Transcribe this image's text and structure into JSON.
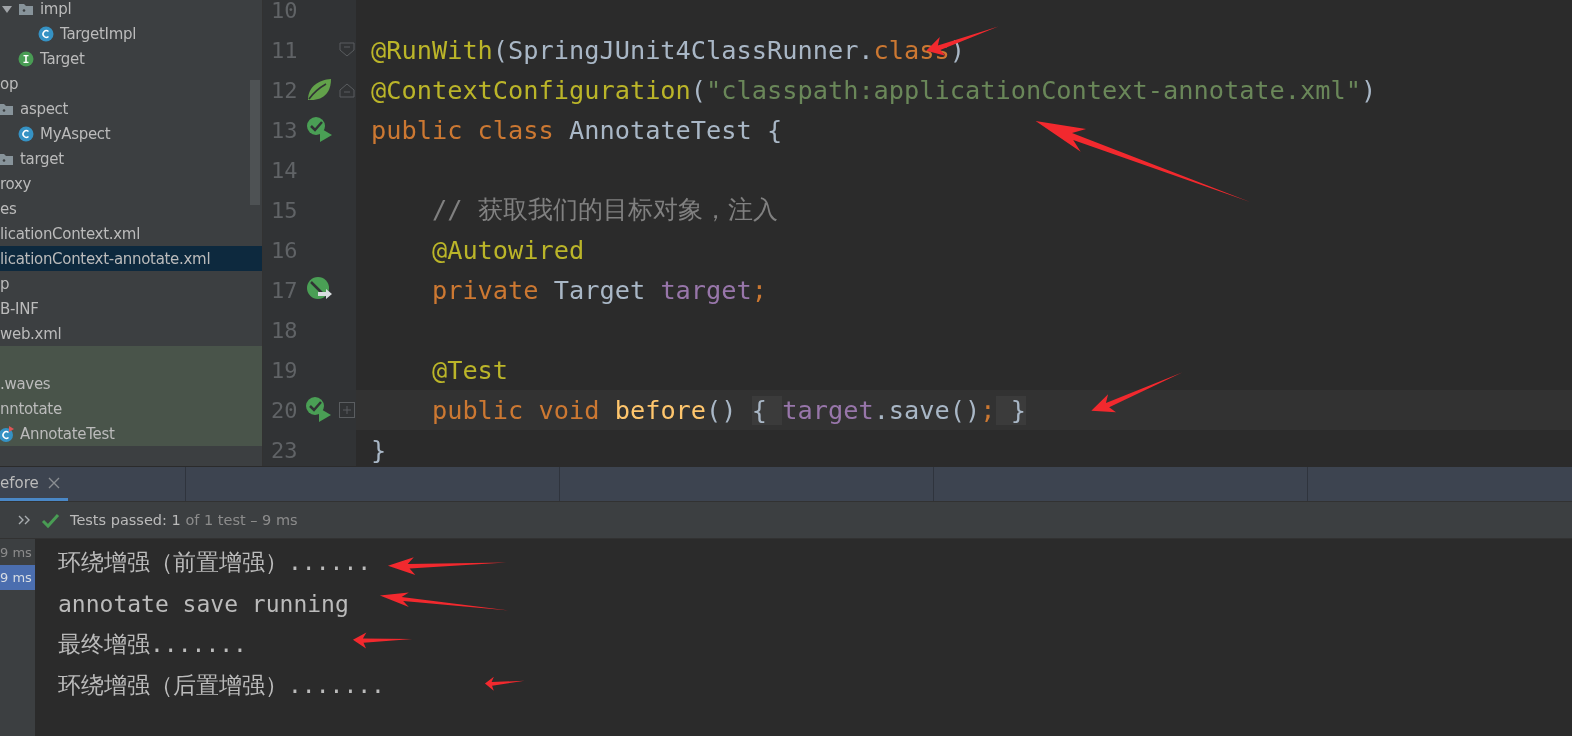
{
  "sidebar": {
    "tree": [
      {
        "kind": "offscreen",
        "children": [
          {
            "kind": "offscreen",
            "children": [
              {
                "kind": "folder",
                "label": "impl",
                "expanded": true,
                "selected": false,
                "children": [
                  {
                    "kind": "class",
                    "label": "TargetImpl",
                    "selected": false
                  }
                ]
              },
              {
                "kind": "interface",
                "label": "Target",
                "selected": false
              }
            ]
          }
        ]
      },
      {
        "kind": "folder",
        "label": "op",
        "expanded": true,
        "selected": false,
        "children": [
          {
            "kind": "folder",
            "label": "aspect",
            "expanded": true,
            "selected": false,
            "children": [
              {
                "kind": "class",
                "label": "MyAspect",
                "selected": false
              }
            ]
          },
          {
            "kind": "folder",
            "label": "target",
            "selected": false
          }
        ]
      },
      {
        "kind": "folder",
        "label": "roxy",
        "selected": false
      },
      {
        "kind": "folder",
        "label": "es",
        "selected": false
      },
      {
        "kind": "file",
        "label": "licationContext.xml",
        "selected": false
      },
      {
        "kind": "file",
        "label": "licationContext-annotate.xml",
        "selected": true
      },
      {
        "kind": "folder",
        "label": "p",
        "selected": false
      },
      {
        "kind": "folder",
        "label": "B-INF",
        "selected": false
      },
      {
        "kind": "file",
        "label": "web.xml",
        "selected": false
      },
      {
        "kind": "folder",
        "test_source": true,
        "selected": false
      },
      {
        "kind": "folder",
        "label": ".waves",
        "test_source": true,
        "selected": false
      },
      {
        "kind": "folder",
        "label": "nntotate",
        "test_source": true,
        "expanded": true,
        "selected": false,
        "children": [
          {
            "kind": "test-class",
            "label": "AnnotateTest",
            "test_source": true,
            "selected": false
          }
        ]
      }
    ]
  },
  "editor": {
    "lines": [
      {
        "number": "10"
      },
      {
        "number": "11",
        "fold_marker": {
          "kind": "start"
        },
        "arrow_mark": true,
        "tokens": [
          {
            "kind": "annotation",
            "text": "@RunWith"
          },
          {
            "kind": "plain",
            "text": "(SpringJUnit4ClassRunner."
          },
          {
            "kind": "keyword",
            "text": "class"
          },
          {
            "kind": "plain",
            "text": ")"
          }
        ]
      },
      {
        "number": "12",
        "gutter_mark": {
          "kind": "leaf"
        },
        "fold_marker": {
          "kind": "end"
        },
        "tokens": [
          {
            "kind": "annotation",
            "text": "@ContextConfiguration"
          },
          {
            "kind": "plain",
            "text": "("
          },
          {
            "kind": "string",
            "text": "\"classpath:applicationContext-annotate.xml\""
          },
          {
            "kind": "plain",
            "text": ")"
          }
        ]
      },
      {
        "number": "13",
        "gutter_mark": {
          "kind": "run"
        },
        "arrow_mark": true,
        "tokens": [
          {
            "kind": "keyword",
            "text": "public class "
          },
          {
            "kind": "plain",
            "text": "AnnotateTest {"
          }
        ]
      },
      {
        "number": "14"
      },
      {
        "number": "15",
        "tokens": [
          {
            "kind": "comment",
            "text": "    // 获取我们的目标对象，注入"
          }
        ]
      },
      {
        "number": "16",
        "tokens": [
          {
            "kind": "annotation",
            "text": "    @Autowired"
          }
        ]
      },
      {
        "number": "17",
        "gutter_mark": {
          "kind": "autowired"
        },
        "tokens": [
          {
            "kind": "keyword",
            "text": "    private "
          },
          {
            "kind": "plain",
            "text": "Target "
          },
          {
            "kind": "field",
            "text": "target"
          },
          {
            "kind": "keyword",
            "text": ";"
          }
        ]
      },
      {
        "number": "18"
      },
      {
        "number": "19",
        "tokens": [
          {
            "kind": "annotation",
            "text": "    @Test"
          }
        ]
      },
      {
        "number": "20",
        "gutter_mark": {
          "kind": "run"
        },
        "fold_marker": {
          "kind": "collapsed"
        },
        "current": true,
        "arrow_mark": true,
        "tokens": [
          {
            "kind": "keyword",
            "text": "    public void "
          },
          {
            "kind": "method",
            "text": "before"
          },
          {
            "kind": "plain",
            "text": "() "
          },
          {
            "kind": "folded",
            "text": "{ "
          },
          {
            "kind": "field",
            "text": "target"
          },
          {
            "kind": "plain",
            "text": ".save()"
          },
          {
            "kind": "keyword",
            "text": ";"
          },
          {
            "kind": "folded",
            "text": " }"
          }
        ]
      },
      {
        "number": "23",
        "tokens": [
          {
            "kind": "plain",
            "text": "}"
          }
        ]
      }
    ]
  },
  "run_panel": {
    "tabs": [
      {
        "label": "efore",
        "selected": true
      }
    ],
    "status": {
      "passed": "Tests passed: 1",
      "detail": "of 1 test – 9 ms"
    },
    "durations": [
      {
        "text": "9 ms",
        "selected": false
      },
      {
        "text": "9 ms",
        "selected": true
      }
    ],
    "console": [
      {
        "text": "环绕增强（前置增强）......",
        "arrow_mark": true
      },
      {
        "text": "annotate save running",
        "arrow_mark": true
      },
      {
        "text": "最终增强.......",
        "arrow_mark": true
      },
      {
        "text": "环绕增强（后置增强）.......",
        "arrow_mark": true
      }
    ]
  }
}
